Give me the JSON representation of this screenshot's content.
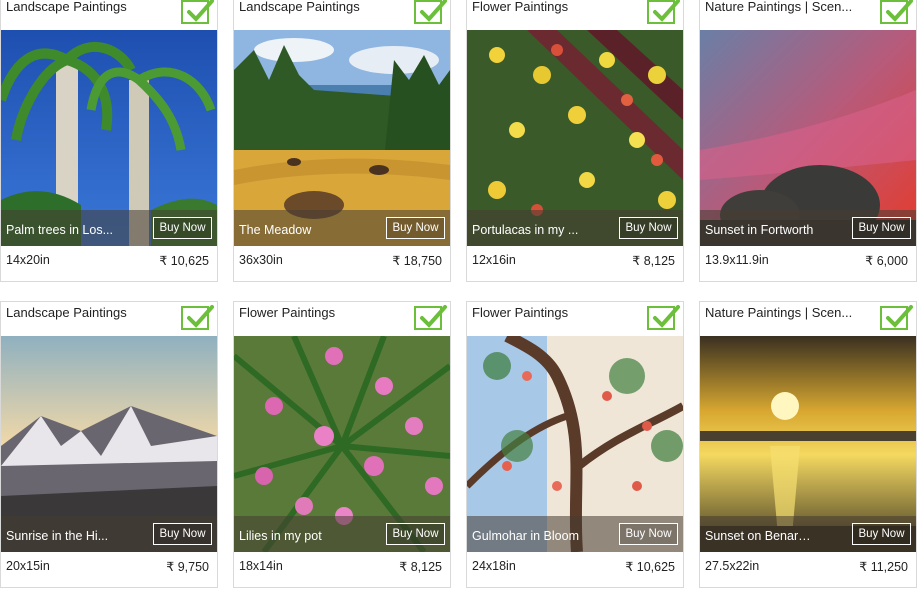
{
  "currency_symbol": "₹",
  "colors": {
    "check_green": "#6cbf3a",
    "card_border": "#d9d9d9",
    "overlay": "#463c32"
  },
  "cards": [
    {
      "category": "Landscape Paintings",
      "title": "Palm trees in Los...",
      "buy_label": "Buy Now",
      "size": "14x20in",
      "price": "₹ 10,625",
      "selected_icon": "checkbox-checked-icon"
    },
    {
      "category": "Landscape Paintings",
      "title": "The Meadow",
      "buy_label": "Buy Now",
      "size": "36x30in",
      "price": "₹ 18,750",
      "selected_icon": "checkbox-checked-icon"
    },
    {
      "category": "Flower Paintings",
      "title": "Portulacas in my ...",
      "buy_label": "Buy Now",
      "size": "12x16in",
      "price": "₹ 8,125",
      "selected_icon": "checkbox-checked-icon"
    },
    {
      "category": "Nature Paintings | Scen...",
      "title": "Sunset in Fortworth",
      "buy_label": "Buy Now",
      "size": "13.9x11.9in",
      "price": "₹ 6,000",
      "selected_icon": "checkbox-checked-icon"
    },
    {
      "category": "Landscape Paintings",
      "title": "Sunrise in the Hi...",
      "buy_label": "Buy Now",
      "size": "20x15in",
      "price": "₹ 9,750",
      "selected_icon": "checkbox-checked-icon"
    },
    {
      "category": "Flower Paintings",
      "title": "Lilies in my pot",
      "buy_label": "Buy Now",
      "size": "18x14in",
      "price": "₹ 8,125",
      "selected_icon": "checkbox-checked-icon"
    },
    {
      "category": "Flower Paintings",
      "title": "Gulmohar in Bloom",
      "buy_label": "Buy Now",
      "size": "24x18in",
      "price": "₹ 10,625",
      "selected_icon": "checkbox-checked-icon"
    },
    {
      "category": "Nature Paintings | Scen...",
      "title": "Sunset on Benaras...",
      "buy_label": "Buy Now",
      "size": "27.5x22in",
      "price": "₹ 11,250",
      "selected_icon": "checkbox-checked-icon"
    }
  ]
}
